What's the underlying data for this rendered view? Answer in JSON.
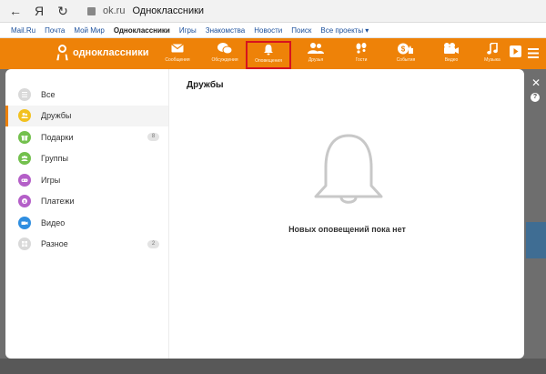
{
  "browser": {
    "back_glyph": "←",
    "yandex_glyph": "Я",
    "reload_glyph": "↻",
    "url": "ok.ru",
    "title": "Одноклассники"
  },
  "links_bar": {
    "items": [
      "Mail.Ru",
      "Почта",
      "Мой Мир",
      "Одноклассники",
      "Игры",
      "Знакомства",
      "Новости",
      "Поиск",
      "Все проекты ▾"
    ],
    "active_index": 3
  },
  "ok_header": {
    "logo_text": "одноклассники",
    "nav": [
      {
        "label": "Сообщения",
        "icon": "envelope-icon"
      },
      {
        "label": "Обсуждения",
        "icon": "chat-bubbles-icon"
      },
      {
        "label": "Оповещения",
        "icon": "bell-icon",
        "highlighted": true
      },
      {
        "label": "Друзья",
        "icon": "friends-icon"
      },
      {
        "label": "Гости",
        "icon": "footprints-icon"
      },
      {
        "label": "События",
        "icon": "events-icon"
      },
      {
        "label": "Видео",
        "icon": "video-camera-icon"
      },
      {
        "label": "Музыка",
        "icon": "music-note-icon"
      }
    ],
    "accent_color": "#ee8208",
    "highlight_color": "#d6131f"
  },
  "overlay": {
    "close_glyph": "✕",
    "help_glyph": "?"
  },
  "sidebar": {
    "items": [
      {
        "label": "Все",
        "icon": "list-icon",
        "color": "#d9d9d9",
        "count": ""
      },
      {
        "label": "Дружбы",
        "icon": "friends-icon",
        "color": "#f2c11f",
        "count": "",
        "active": true
      },
      {
        "label": "Подарки",
        "icon": "gift-icon",
        "color": "#73c04d",
        "count": "8"
      },
      {
        "label": "Группы",
        "icon": "groups-icon",
        "color": "#73c04d",
        "count": ""
      },
      {
        "label": "Игры",
        "icon": "gamepad-icon",
        "color": "#b45fc8",
        "count": ""
      },
      {
        "label": "Платежи",
        "icon": "coin-icon",
        "color": "#b45fc8",
        "count": ""
      },
      {
        "label": "Видео",
        "icon": "video-camera-icon",
        "color": "#2f8ee0",
        "count": ""
      },
      {
        "label": "Разное",
        "icon": "grid-icon",
        "color": "#d9d9d9",
        "count": "2"
      }
    ]
  },
  "content": {
    "title": "Дружбы",
    "empty_message": "Новых оповещений пока нет"
  }
}
